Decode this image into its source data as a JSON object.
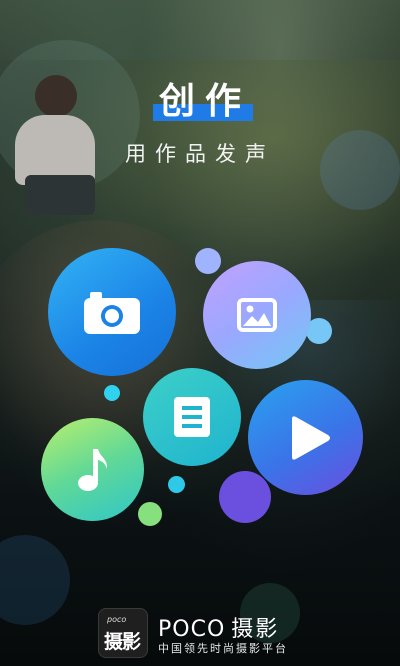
{
  "header": {
    "title": "创作",
    "subtitle": "用作品发声"
  },
  "menu": {
    "items": [
      {
        "key": "camera",
        "icon": "camera-icon"
      },
      {
        "key": "photo",
        "icon": "image-icon"
      },
      {
        "key": "article",
        "icon": "document-icon"
      },
      {
        "key": "music",
        "icon": "music-note-icon"
      },
      {
        "key": "video",
        "icon": "play-icon"
      }
    ]
  },
  "footer": {
    "logo_small": "poco",
    "logo_big": "摄影",
    "brand_en": "POCO",
    "brand_cn": "摄影",
    "tagline": "中国领先时尚摄影平台"
  },
  "colors": {
    "accent": "#1f7be6",
    "camera": "#1b83e6",
    "photo": "#9aa8ff",
    "article": "#1fb3cf",
    "music": "#60d898",
    "video": "#3a74e8"
  }
}
